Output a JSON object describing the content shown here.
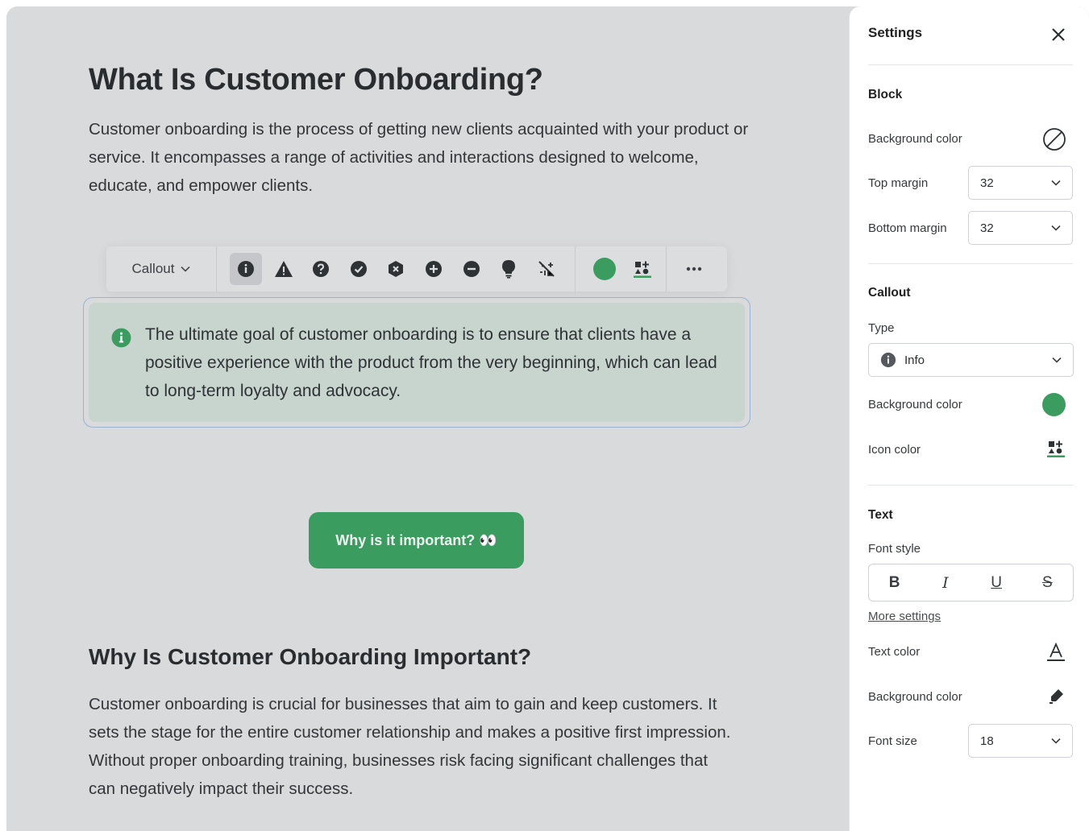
{
  "article": {
    "title": "What Is Customer Onboarding?",
    "intro": "Customer onboarding is the process of getting new clients acquainted with your product or service. It encompasses a range of activities and interactions designed to welcome, educate, and empower clients.",
    "callout_text": "The ultimate goal of customer onboarding is to ensure that clients have a positive experience with the product from the very beginning, which can lead to long-term loyalty and advocacy.",
    "button_label": "Why is it important? 👀",
    "section_title": "Why Is Customer Onboarding Important?",
    "section_body": "Customer onboarding is crucial for businesses that aim to gain and keep customers. It sets the stage for the entire customer relationship and makes a positive first impression. Without proper onboarding training, businesses risk facing significant challenges that can negatively impact their success."
  },
  "toolbar": {
    "block_type_label": "Callout",
    "icon_options": [
      "info-icon",
      "warning-icon",
      "question-icon",
      "check-icon",
      "error-icon",
      "plus-icon",
      "minus-icon",
      "lightbulb-icon",
      "no-icon"
    ],
    "active_icon": "info-icon",
    "accent_color": "#3a9c5e"
  },
  "settings": {
    "title": "Settings",
    "block": {
      "heading": "Block",
      "background_color_label": "Background color",
      "top_margin_label": "Top margin",
      "top_margin_value": "32",
      "bottom_margin_label": "Bottom margin",
      "bottom_margin_value": "32"
    },
    "callout": {
      "heading": "Callout",
      "type_label": "Type",
      "type_value": "Info",
      "background_color_label": "Background color",
      "background_color": "#3a9c5e",
      "icon_color_label": "Icon color"
    },
    "text": {
      "heading": "Text",
      "font_style_label": "Font style",
      "bold": "B",
      "italic": "I",
      "underline": "U",
      "strike": "S",
      "more_settings": "More settings",
      "text_color_label": "Text color",
      "background_color_label": "Background color",
      "font_size_label": "Font size",
      "font_size_value": "18"
    }
  }
}
